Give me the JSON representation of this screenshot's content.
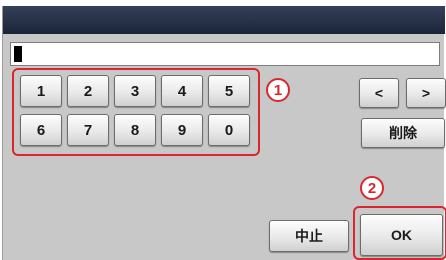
{
  "input": {
    "value": ""
  },
  "keypad": {
    "row1": [
      "1",
      "2",
      "3",
      "4",
      "5"
    ],
    "row2": [
      "6",
      "7",
      "8",
      "9",
      "0"
    ]
  },
  "nav": {
    "left": "<",
    "right": ">",
    "delete": "削除"
  },
  "actions": {
    "cancel": "中止",
    "ok": "OK"
  },
  "callouts": {
    "keypad": "1",
    "ok": "2"
  },
  "colors": {
    "title_bar": "#1c2538",
    "highlight": "#d8282e",
    "panel": "#c8c8c8"
  }
}
